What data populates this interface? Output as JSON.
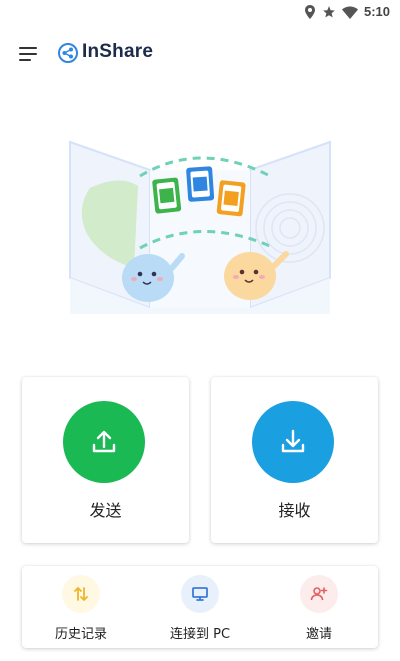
{
  "status_bar": {
    "time": "5:10",
    "icons": [
      "location-icon",
      "star-icon",
      "wifi-icon"
    ]
  },
  "app_bar": {
    "menu_icon": "hamburger-menu-icon",
    "logo_icon": "share-logo-icon",
    "title": "InShare"
  },
  "hero": {
    "illustration": "file-transfer-illustration"
  },
  "actions": {
    "send": {
      "label": "发送",
      "icon": "upload-icon",
      "color": "#1bb954"
    },
    "receive": {
      "label": "接收",
      "icon": "download-icon",
      "color": "#1a9fe0"
    }
  },
  "bottom_bar": {
    "items": [
      {
        "label": "历史记录",
        "icon": "history-icon",
        "color": "#f0b429",
        "bg": "#fff8e3"
      },
      {
        "label": "连接到 PC",
        "icon": "monitor-icon",
        "color": "#3b7bd6",
        "bg": "#e8f0fc"
      },
      {
        "label": "邀请",
        "icon": "add-user-icon",
        "color": "#e26060",
        "bg": "#fdecec"
      }
    ]
  }
}
